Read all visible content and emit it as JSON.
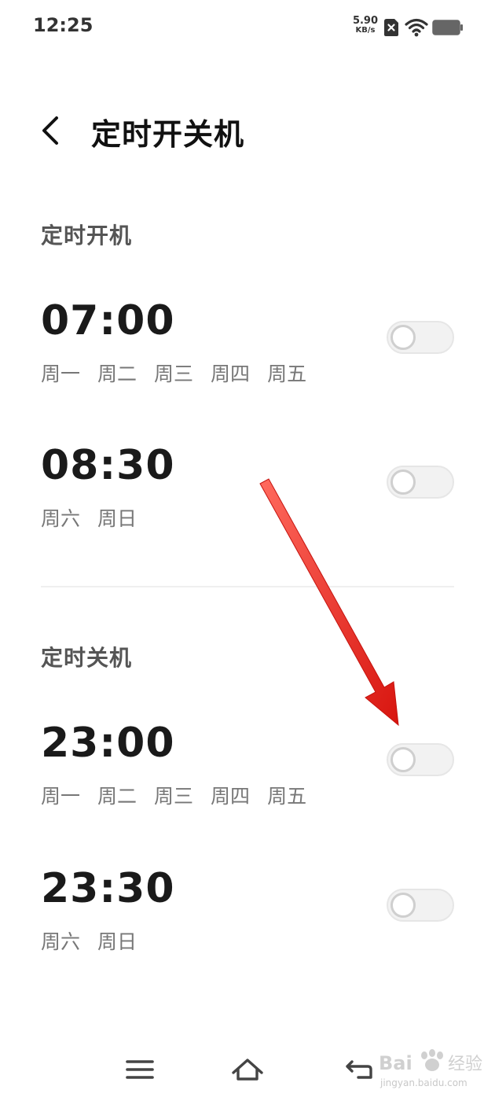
{
  "status_bar": {
    "time": "12:25",
    "net_speed_value": "5.90",
    "net_speed_unit": "KB/s",
    "icons": [
      "sim-x-icon",
      "wifi-icon",
      "battery-icon"
    ]
  },
  "header": {
    "back_icon": "chevron-left-icon",
    "title": "定时开关机"
  },
  "power_on": {
    "title": "定时开机",
    "items": [
      {
        "time": "07:00",
        "days": [
          "周一",
          "周二",
          "周三",
          "周四",
          "周五"
        ],
        "enabled": false
      },
      {
        "time": "08:30",
        "days": [
          "周六",
          "周日"
        ],
        "enabled": false
      }
    ]
  },
  "power_off": {
    "title": "定时关机",
    "items": [
      {
        "time": "23:00",
        "days": [
          "周一",
          "周二",
          "周三",
          "周四",
          "周五"
        ],
        "enabled": false
      },
      {
        "time": "23:30",
        "days": [
          "周六",
          "周日"
        ],
        "enabled": false
      }
    ]
  },
  "nav_bar": {
    "icons": [
      "menu-icon",
      "home-icon",
      "back-nav-icon"
    ]
  },
  "annotation": {
    "arrow_color": "#e8231f"
  },
  "watermark": {
    "text": "Bai 经验",
    "url": "jingyan.baidu.com"
  },
  "colors": {
    "background": "#ffffff",
    "toggle_off_track": "#f2f2f2",
    "toggle_off_knob_border": "#cfcfcf",
    "section_title": "#555555",
    "days_text": "#777777"
  }
}
